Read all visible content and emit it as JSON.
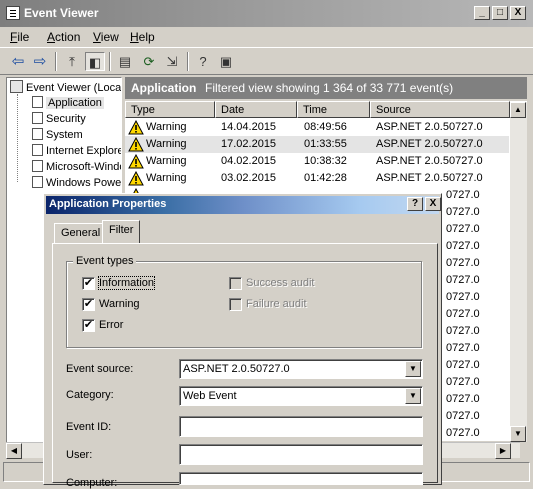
{
  "window": {
    "title": "Event Viewer",
    "minimize": "_",
    "maximize": "□",
    "close": "X"
  },
  "menu": [
    "File",
    "Action",
    "View",
    "Help"
  ],
  "tree": {
    "root": "Event Viewer (Local)",
    "items": [
      "Application",
      "Security",
      "System",
      "Internet Explorer",
      "Microsoft-Windows",
      "Windows PowerShell"
    ]
  },
  "panel": {
    "heading": "Application",
    "info": "Filtered view showing 1 364 of 33 771 event(s)"
  },
  "table": {
    "columns": [
      "Type",
      "Date",
      "Time",
      "Source"
    ],
    "rows": [
      {
        "type": "Warning",
        "date": "14.04.2015",
        "time": "08:49:56",
        "source": "ASP.NET 2.0.50727.0"
      },
      {
        "type": "Warning",
        "date": "17.02.2015",
        "time": "01:33:55",
        "source": "ASP.NET 2.0.50727.0"
      },
      {
        "type": "Warning",
        "date": "04.02.2015",
        "time": "10:38:32",
        "source": "ASP.NET 2.0.50727.0"
      },
      {
        "type": "Warning",
        "date": "03.02.2015",
        "time": "01:42:28",
        "source": "ASP.NET 2.0.50727.0"
      }
    ],
    "partial_source_tail": "0727.0"
  },
  "dialog": {
    "title": "Application Properties",
    "help": "?",
    "close": "X",
    "tabs": [
      "General",
      "Filter"
    ],
    "active_tab": "Filter",
    "event_types_label": "Event types",
    "checkboxes": [
      {
        "label": "Information",
        "checked": true,
        "enabled": true
      },
      {
        "label": "Warning",
        "checked": true,
        "enabled": true
      },
      {
        "label": "Error",
        "checked": true,
        "enabled": true
      },
      {
        "label": "Success audit",
        "checked": false,
        "enabled": false
      },
      {
        "label": "Failure audit",
        "checked": false,
        "enabled": false
      }
    ],
    "check_glyph": "✔",
    "fields": {
      "event_source_label": "Event source:",
      "event_source_value": "ASP.NET 2.0.50727.0",
      "category_label": "Category:",
      "category_value": "Web Event",
      "event_id_label": "Event ID:",
      "event_id_value": "",
      "user_label": "User:",
      "user_value": "",
      "computer_label": "Computer:",
      "computer_value": ""
    }
  },
  "colors": {
    "warning_yellow": "#ffd800",
    "title_gradient_start": "#0a246a"
  }
}
